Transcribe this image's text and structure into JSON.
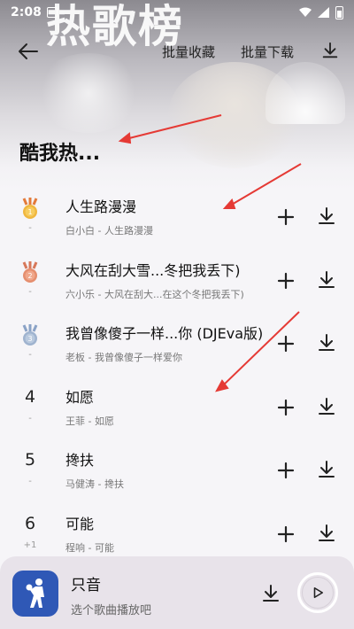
{
  "status_bar": {
    "time": "2:08"
  },
  "hero": {
    "big_title": "热歌榜"
  },
  "toolbar": {
    "batch_collect": "批量收藏",
    "batch_download": "批量下载"
  },
  "playlist": {
    "title": "酷我热..."
  },
  "songs": [
    {
      "rank": "1",
      "change": "-",
      "title": "人生路漫漫",
      "subtitle": "白小白 - 人生路漫漫"
    },
    {
      "rank": "2",
      "change": "-",
      "title": "大风在刮大雪...冬把我丢下)",
      "subtitle": "六小乐 - 大风在刮大...在这个冬把我丢下)"
    },
    {
      "rank": "3",
      "change": "-",
      "title": "我曾像傻子一样...你 (DJEva版)",
      "subtitle": "老板 - 我曾像傻子一样爱你"
    },
    {
      "rank": "4",
      "change": "-",
      "title": "如愿",
      "subtitle": "王菲 - 如愿"
    },
    {
      "rank": "5",
      "change": "-",
      "title": "搀扶",
      "subtitle": "马健涛 - 搀扶"
    },
    {
      "rank": "6",
      "change": "+1",
      "title": "可能",
      "subtitle": "程响 - 可能"
    }
  ],
  "player": {
    "title": "只音",
    "subtitle": "选个歌曲播放吧"
  },
  "colors": {
    "accent_red": "#e53a35",
    "cover_blue": "#2f58b6",
    "gold": "#e8a93a",
    "bronze": "#e58e6e",
    "silver": "#9fb3cf"
  }
}
